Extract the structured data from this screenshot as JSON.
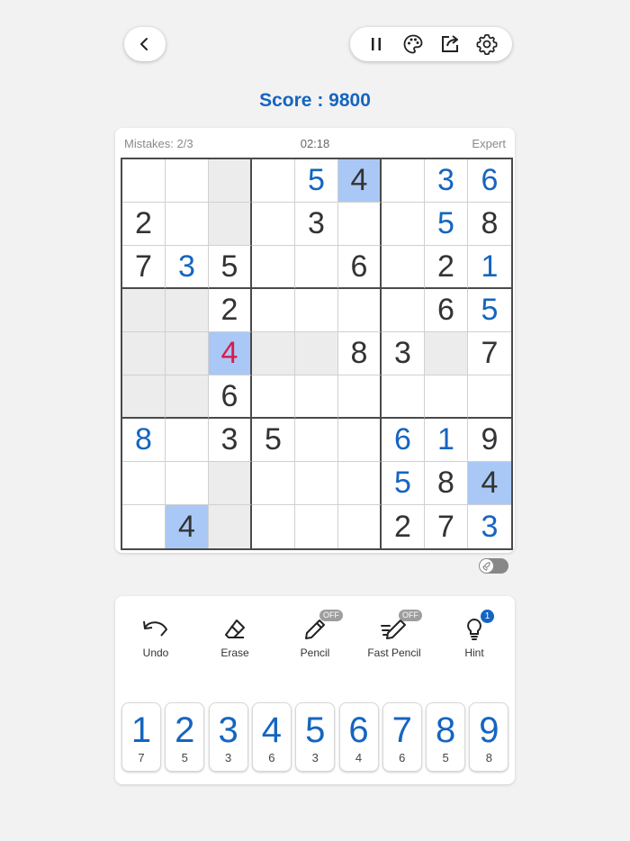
{
  "score": {
    "text": "Score : 9800"
  },
  "info": {
    "mistakes": "Mistakes: 2/3",
    "timer": "02:18",
    "difficulty": "Expert"
  },
  "board": {
    "values": [
      [
        "",
        "",
        "",
        "",
        "5",
        "4",
        "",
        "3",
        "6"
      ],
      [
        "2",
        "",
        "",
        "",
        "3",
        "",
        "",
        "5",
        "8"
      ],
      [
        "7",
        "3",
        "5",
        "",
        "",
        "6",
        "",
        "2",
        "1"
      ],
      [
        "",
        "",
        "2",
        "",
        "",
        "",
        "",
        "6",
        "5"
      ],
      [
        "",
        "",
        "4",
        "",
        "",
        "8",
        "3",
        "",
        "7"
      ],
      [
        "",
        "",
        "6",
        "",
        "",
        "",
        "",
        "",
        ""
      ],
      [
        "8",
        "",
        "3",
        "5",
        "",
        "",
        "6",
        "1",
        "9"
      ],
      [
        "",
        "",
        "",
        "",
        "",
        "",
        "5",
        "8",
        "4"
      ],
      [
        "",
        "4",
        "",
        "",
        "",
        "",
        "2",
        "7",
        "3"
      ]
    ],
    "states": [
      [
        "g",
        "g",
        "h",
        "g",
        "u",
        "s",
        "g",
        "u",
        "u"
      ],
      [
        "g",
        "g",
        "h",
        "g",
        "g",
        "g",
        "g",
        "u",
        "g"
      ],
      [
        "g",
        "u",
        "g",
        "g",
        "g",
        "g",
        "g",
        "g",
        "u"
      ],
      [
        "h",
        "h",
        "g",
        "g",
        "g",
        "g",
        "g",
        "g",
        "u"
      ],
      [
        "h",
        "h",
        "e",
        "h",
        "h",
        "g",
        "g",
        "h",
        "g"
      ],
      [
        "h",
        "h",
        "g",
        "g",
        "g",
        "g",
        "g",
        "g",
        "g"
      ],
      [
        "u",
        "g",
        "g",
        "g",
        "g",
        "g",
        "u",
        "u",
        "g"
      ],
      [
        "g",
        "g",
        "h",
        "g",
        "g",
        "g",
        "u",
        "g",
        "s"
      ],
      [
        "g",
        "s",
        "h",
        "g",
        "g",
        "g",
        "g",
        "g",
        "u"
      ]
    ],
    "colors": {
      "given": "#333333",
      "user": "#1565c0",
      "error": "#d81b4f",
      "selected_bg": "#a9c8f5",
      "highlight_bg": "#ececec"
    }
  },
  "actions": [
    {
      "name": "undo",
      "label": "Undo",
      "icon": "undo-icon"
    },
    {
      "name": "erase",
      "label": "Erase",
      "icon": "eraser-icon"
    },
    {
      "name": "pencil",
      "label": "Pencil",
      "icon": "pencil-icon",
      "badge": "OFF"
    },
    {
      "name": "fast-pencil",
      "label": "Fast Pencil",
      "icon": "fast-pencil-icon",
      "badge": "OFF"
    },
    {
      "name": "hint",
      "label": "Hint",
      "icon": "lightbulb-icon",
      "badge": "1"
    }
  ],
  "numpad": [
    {
      "digit": "1",
      "remaining": "7"
    },
    {
      "digit": "2",
      "remaining": "5"
    },
    {
      "digit": "3",
      "remaining": "3"
    },
    {
      "digit": "4",
      "remaining": "6"
    },
    {
      "digit": "5",
      "remaining": "3"
    },
    {
      "digit": "6",
      "remaining": "4"
    },
    {
      "digit": "7",
      "remaining": "6"
    },
    {
      "digit": "8",
      "remaining": "5"
    },
    {
      "digit": "9",
      "remaining": "8"
    }
  ],
  "icons": [
    "back-icon",
    "pause-icon",
    "palette-icon",
    "share-icon",
    "settings-icon",
    "rocket-icon"
  ]
}
